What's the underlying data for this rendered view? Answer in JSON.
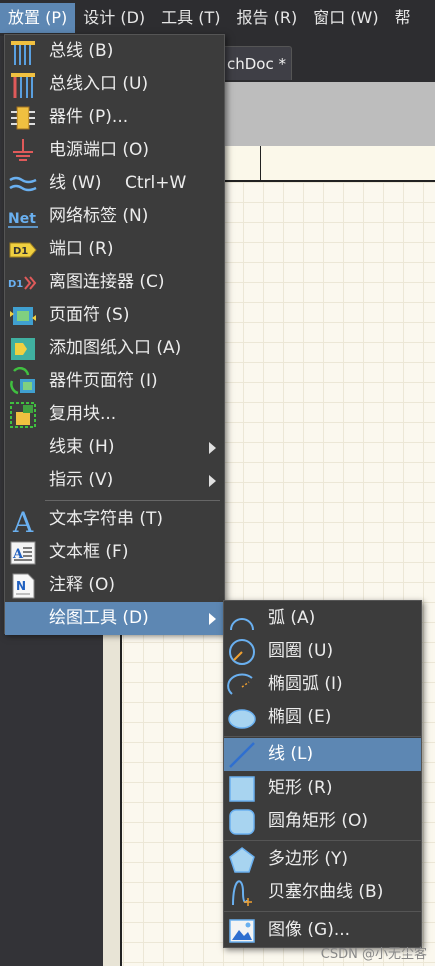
{
  "menubar": {
    "items": [
      "放置 (P)",
      "设计 (D)",
      "工具 (T)",
      "报告 (R)",
      "窗口 (W)",
      "帮"
    ]
  },
  "tab": {
    "label": "chDoc *"
  },
  "place_menu": {
    "items": [
      {
        "label": "总线 (B)",
        "icon": "bus-icon"
      },
      {
        "label": "总线入口 (U)",
        "icon": "bus-entry-icon"
      },
      {
        "label": "器件 (P)...",
        "icon": "part-icon"
      },
      {
        "label": "电源端口 (O)",
        "icon": "power-port-icon"
      },
      {
        "label": "线 (W)",
        "shortcut": "Ctrl+W",
        "icon": "wire-icon"
      },
      {
        "label": "网络标签 (N)",
        "icon": "net-label-icon"
      },
      {
        "label": "端口 (R)",
        "icon": "port-icon"
      },
      {
        "label": "离图连接器 (C)",
        "icon": "off-sheet-connector-icon"
      },
      {
        "label": "页面符 (S)",
        "icon": "sheet-symbol-icon"
      },
      {
        "label": "添加图纸入口 (A)",
        "icon": "sheet-entry-icon"
      },
      {
        "label": "器件页面符 (I)",
        "icon": "device-sheet-symbol-icon"
      },
      {
        "label": "复用块...",
        "icon": "reuse-block-icon"
      },
      {
        "label": "线束 (H)",
        "icon": ""
      },
      {
        "label": "指示 (V)",
        "icon": ""
      },
      {
        "label": "文本字符串 (T)",
        "icon": "text-string-icon"
      },
      {
        "label": "文本框 (F)",
        "icon": "text-frame-icon"
      },
      {
        "label": "注释 (O)",
        "icon": "note-icon"
      },
      {
        "label": "绘图工具 (D)",
        "icon": ""
      }
    ]
  },
  "drawing_submenu": {
    "items": [
      {
        "label": "弧 (A)",
        "icon": "arc-icon"
      },
      {
        "label": "圆圈 (U)",
        "icon": "circle-icon"
      },
      {
        "label": "椭圆弧 (I)",
        "icon": "elliptical-arc-icon"
      },
      {
        "label": "椭圆 (E)",
        "icon": "ellipse-icon"
      },
      {
        "label": "线 (L)",
        "icon": "line-icon"
      },
      {
        "label": "矩形 (R)",
        "icon": "rectangle-icon"
      },
      {
        "label": "圆角矩形 (O)",
        "icon": "round-rectangle-icon"
      },
      {
        "label": "多边形 (Y)",
        "icon": "polygon-icon"
      },
      {
        "label": "贝塞尔曲线 (B)",
        "icon": "bezier-icon"
      },
      {
        "label": "图像 (G)...",
        "icon": "image-icon"
      }
    ]
  },
  "watermark": "CSDN @小无尘客",
  "colors": {
    "accent": "#5d87b3",
    "menu_bg": "#3c3c3c"
  }
}
